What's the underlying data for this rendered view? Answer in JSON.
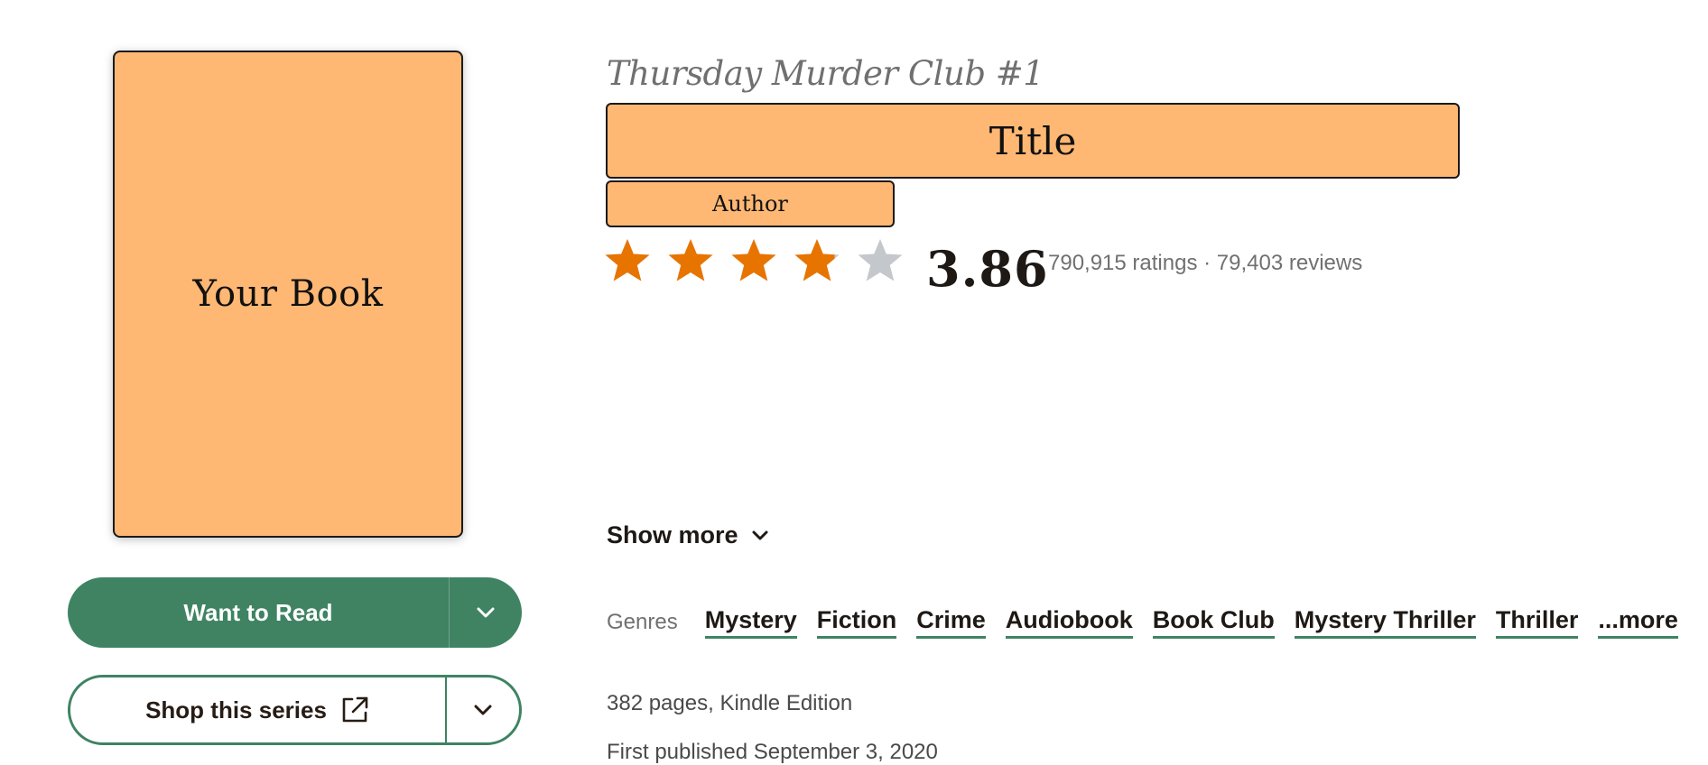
{
  "cover": {
    "text": "Your Book"
  },
  "buttons": {
    "want_to_read": "Want to Read",
    "shop_series": "Shop this series"
  },
  "book": {
    "series": "Thursday Murder Club #1",
    "title": "Title",
    "author": "Author"
  },
  "rating": {
    "average": "3.86",
    "average_value": 3.86,
    "max_stars": 5,
    "counts_text": "790,915 ratings · 79,403 reviews",
    "filled_color": "#e87400",
    "empty_color": "#c4c8cc"
  },
  "description": {
    "show_more": "Show more"
  },
  "genres": {
    "label": "Genres",
    "items": [
      "Mystery",
      "Fiction",
      "Crime",
      "Audiobook",
      "Book Club",
      "Mystery Thriller",
      "Thriller"
    ],
    "more": "...more"
  },
  "details": {
    "format": "382 pages, Kindle Edition",
    "published": "First published September 3, 2020"
  },
  "colors": {
    "accent_green": "#3f8363",
    "placeholder_orange": "#ffb874"
  }
}
